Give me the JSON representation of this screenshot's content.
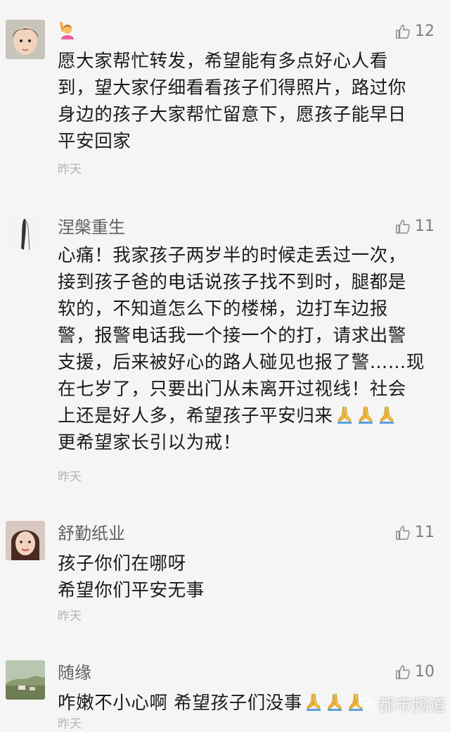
{
  "comments": [
    {
      "user": "",
      "likes": "12",
      "lines": [
        "愿大家帮忙转发，希望能有多点好心人看",
        "到，望大家仔细看看孩子们得照片，路过你",
        "身边的孩子大家帮忙留意下，愿孩子能早日",
        "平安回家"
      ],
      "time": "昨天"
    },
    {
      "user": "涅槃重生",
      "likes": "11",
      "lines": [
        "心痛！我家孩子两岁半的时候走丢过一次，",
        "接到孩子爸的电话说孩子找不到时，腿都是",
        "软的，不知道怎么下的楼梯，边打车边报",
        "警，报警电话我一个接一个的打，请求出警",
        "支援，后来被好心的路人碰见也报了警……现",
        "在七岁了，只要出门从未离开过视线！社会",
        "上还是好人多，希望孩子平安归来",
        "更希望家长引以为戒！"
      ],
      "time": "昨天"
    },
    {
      "user": "舒勤纸业",
      "likes": "11",
      "lines": [
        "孩子你们在哪呀",
        "希望你们平安无事"
      ],
      "time": "昨天"
    },
    {
      "user": "随缘",
      "likes": "10",
      "lines": [
        "咋嫩不小心啊  希望孩子们没事"
      ],
      "time": "昨天"
    }
  ],
  "watermark": "都市频道",
  "icons": {
    "like": "thumbs-up-icon",
    "pray": "folded-hands-icon",
    "raise_hand": "person-raising-hand-icon"
  },
  "colors": {
    "background": "#f5f5f5",
    "text": "#1b1b1b",
    "name": "#616161",
    "meta": "#b3b3b3"
  }
}
